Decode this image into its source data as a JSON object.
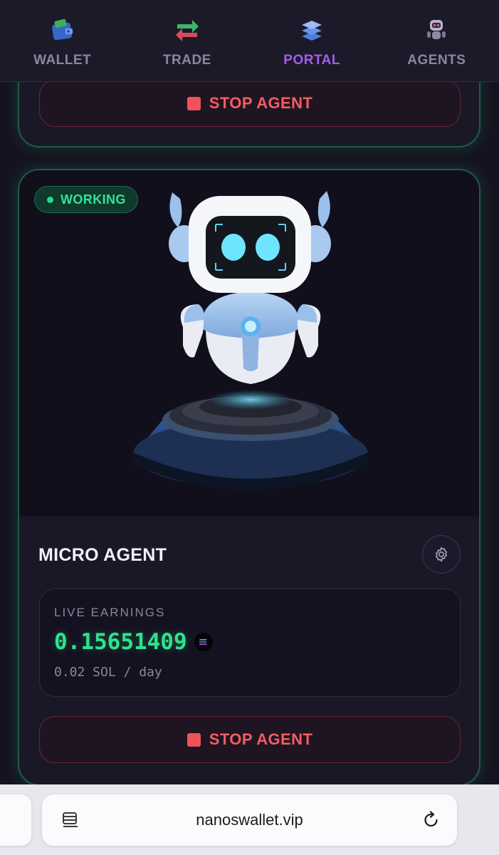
{
  "nav": {
    "items": [
      {
        "label": "WALLET",
        "icon": "wallet-icon",
        "active": false
      },
      {
        "label": "TRADE",
        "icon": "trade-arrows-icon",
        "active": false
      },
      {
        "label": "PORTAL",
        "icon": "portal-layers-icon",
        "active": true
      },
      {
        "label": "AGENTS",
        "icon": "robot-icon",
        "active": false
      }
    ],
    "active_color": "#a35cf2",
    "inactive_color": "#8b86a0"
  },
  "top_card": {
    "stop_label": "STOP AGENT"
  },
  "agent_card": {
    "status": "WORKING",
    "status_color": "#2ee39a",
    "image": "robot-on-pedestal",
    "title": "MICRO AGENT",
    "settings_icon": "gear-icon",
    "earnings": {
      "label": "LIVE EARNINGS",
      "value": "0.15651409",
      "currency_icon": "solana-icon",
      "rate": "0.02 SOL / day",
      "value_color": "#2ee38e"
    },
    "stop_label": "STOP AGENT",
    "stop_color": "#f0525c"
  },
  "browser": {
    "url": "nanoswallet.vip",
    "reader_icon": "reader-mode-icon",
    "reload_icon": "reload-icon"
  }
}
